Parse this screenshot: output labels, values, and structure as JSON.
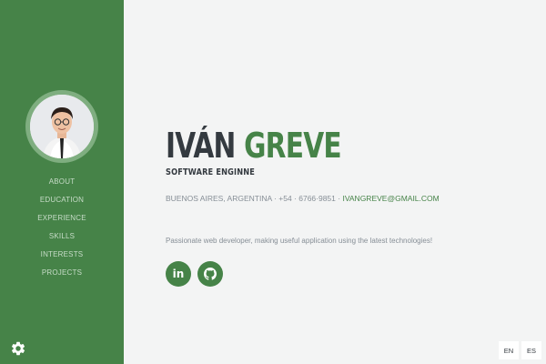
{
  "sidebar": {
    "nav_items": [
      {
        "label": "ABOUT"
      },
      {
        "label": "EDUCATION"
      },
      {
        "label": "EXPERIENCE"
      },
      {
        "label": "SKILLS"
      },
      {
        "label": "INTERESTS"
      },
      {
        "label": "PROJECTS"
      }
    ],
    "settings_icon": "gear-icon"
  },
  "profile": {
    "first_name": "IVÁN",
    "last_name": "GREVE",
    "title": "SOFTWARE ENGINNE",
    "location": "BUENOS AIRES, ARGENTINA",
    "separator": "·",
    "phone": "+54 · 6766·9851",
    "email": "IVANGREVE@GMAIL.COM",
    "tagline": "Passionate web developer, making useful application using the latest technologies!"
  },
  "social": [
    {
      "icon": "linkedin-icon",
      "text": "in"
    },
    {
      "icon": "github-icon"
    }
  ],
  "languages": [
    "EN",
    "ES"
  ],
  "colors": {
    "primary": "#468348",
    "sidebar_text": "#c7dcc8",
    "heading": "#343a40",
    "muted": "#868e96",
    "background": "#f3f4f4"
  }
}
